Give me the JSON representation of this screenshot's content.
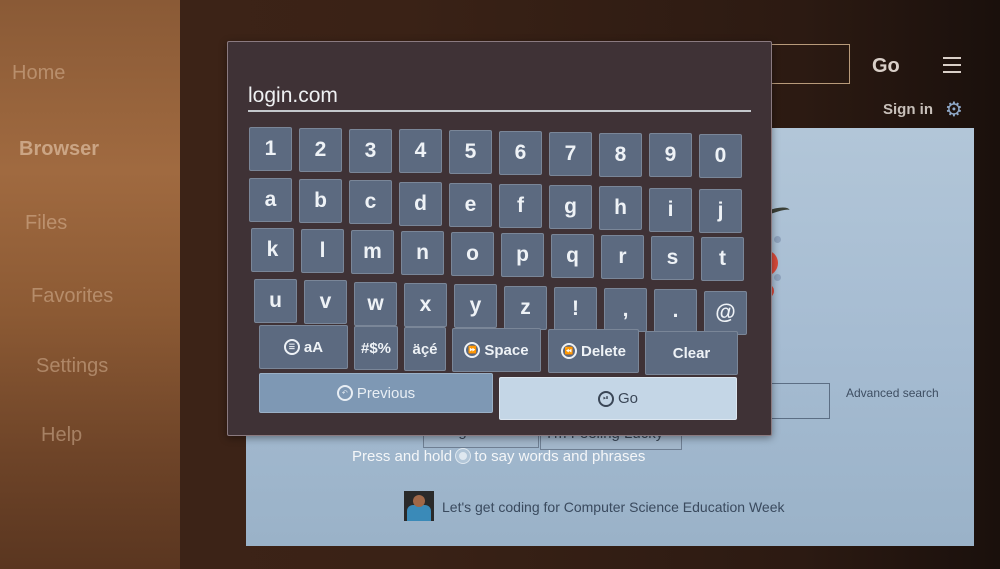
{
  "sidebar": {
    "items": [
      {
        "label": "Home",
        "active": false
      },
      {
        "label": "Browser",
        "active": true
      },
      {
        "label": "Files",
        "active": false
      },
      {
        "label": "Favorites",
        "active": false
      },
      {
        "label": "Settings",
        "active": false
      },
      {
        "label": "Help",
        "active": false
      }
    ]
  },
  "topbar": {
    "go_label": "Go",
    "menu_icon": "hamburger-menu-icon",
    "sign_in_label": "Sign in",
    "settings_icon": "gear-icon"
  },
  "page": {
    "advanced_search_label": "Advanced search",
    "google_search_label": "Google Search",
    "feeling_lucky_label": "I'm Feeling Lucky",
    "voice_hint_before": "Press and hold",
    "voice_hint_after": "to say words and phrases",
    "doodle_promo": "Let's get coding for Computer Science Education Week"
  },
  "keyboard": {
    "input_value": "login.com",
    "rows": [
      [
        "1",
        "2",
        "3",
        "4",
        "5",
        "6",
        "7",
        "8",
        "9",
        "0"
      ],
      [
        "a",
        "b",
        "c",
        "d",
        "e",
        "f",
        "g",
        "h",
        "i",
        "j"
      ],
      [
        "k",
        "l",
        "m",
        "n",
        "o",
        "p",
        "q",
        "r",
        "s",
        "t"
      ],
      [
        "u",
        "v",
        "w",
        "x",
        "y",
        "z",
        "!",
        ",",
        ".",
        "@"
      ]
    ],
    "function_keys": {
      "case_toggle": {
        "label": "aA",
        "icon": "menu-button-icon"
      },
      "symbols": {
        "label": "#$%"
      },
      "accents": {
        "label": "äçé"
      },
      "space": {
        "label": "Space",
        "icon": "fast-forward-icon"
      },
      "delete": {
        "label": "Delete",
        "icon": "rewind-icon"
      },
      "clear": {
        "label": "Clear"
      }
    },
    "previous": {
      "label": "Previous",
      "icon": "back-button-icon"
    },
    "go": {
      "label": "Go",
      "icon": "play-pause-icon"
    }
  },
  "colors": {
    "key_bg": "#5c6a80",
    "keyboard_bg": "#3f3236",
    "go_button_bg": "#c4d6e6",
    "previous_button_bg": "#7e98b4",
    "doodle_red": "#d84a3a"
  }
}
